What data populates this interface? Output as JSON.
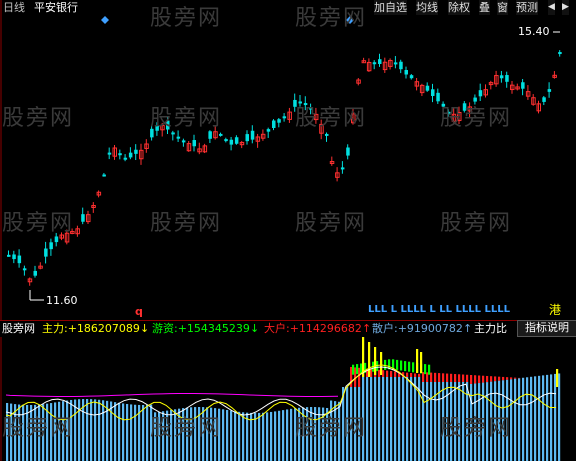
{
  "header": {
    "period": "日线",
    "stock_name": "平安银行",
    "period_color": "#c0c0c0",
    "stock_color": "#ffffff"
  },
  "toolbar": {
    "items": [
      "加自选",
      "均线",
      "除权",
      "叠",
      "窗",
      "预测"
    ],
    "nav_icons": [
      "arrow-left-icon",
      "arrow-right-icon"
    ]
  },
  "price": {
    "high_label": "15.40",
    "low_label": "11.60"
  },
  "signals": {
    "L_marks": "LLL   L   LLLL   L   LL  LLLL  LLLL",
    "end_label": "港",
    "q_mark": "q"
  },
  "indicator": {
    "title": "股旁网",
    "main_force": {
      "label": "主力:",
      "value": "+186207089",
      "arrow": "↓",
      "color": "#ffff00"
    },
    "game_funds": {
      "label": "游资:",
      "value": "+154345239",
      "arrow": "↓",
      "color": "#00ff00"
    },
    "big_holder": {
      "label": "大户:",
      "value": "+114296682",
      "arrow": "↑",
      "color": "#ff2020"
    },
    "retail": {
      "label": "散户:",
      "value": "+91900782",
      "arrow": "↑",
      "color": "#6fa8dc"
    },
    "ratio_label": "主力比",
    "help_button": "指标说明"
  },
  "watermark": "股旁网",
  "colors": {
    "up": "#ff3030",
    "down": "#00e0e0",
    "background": "#000000",
    "retail_bars": "#5db8f0",
    "yellow": "#ffff00",
    "green": "#00ff00",
    "red": "#ff2020",
    "magenta": "#ff00ff"
  }
}
